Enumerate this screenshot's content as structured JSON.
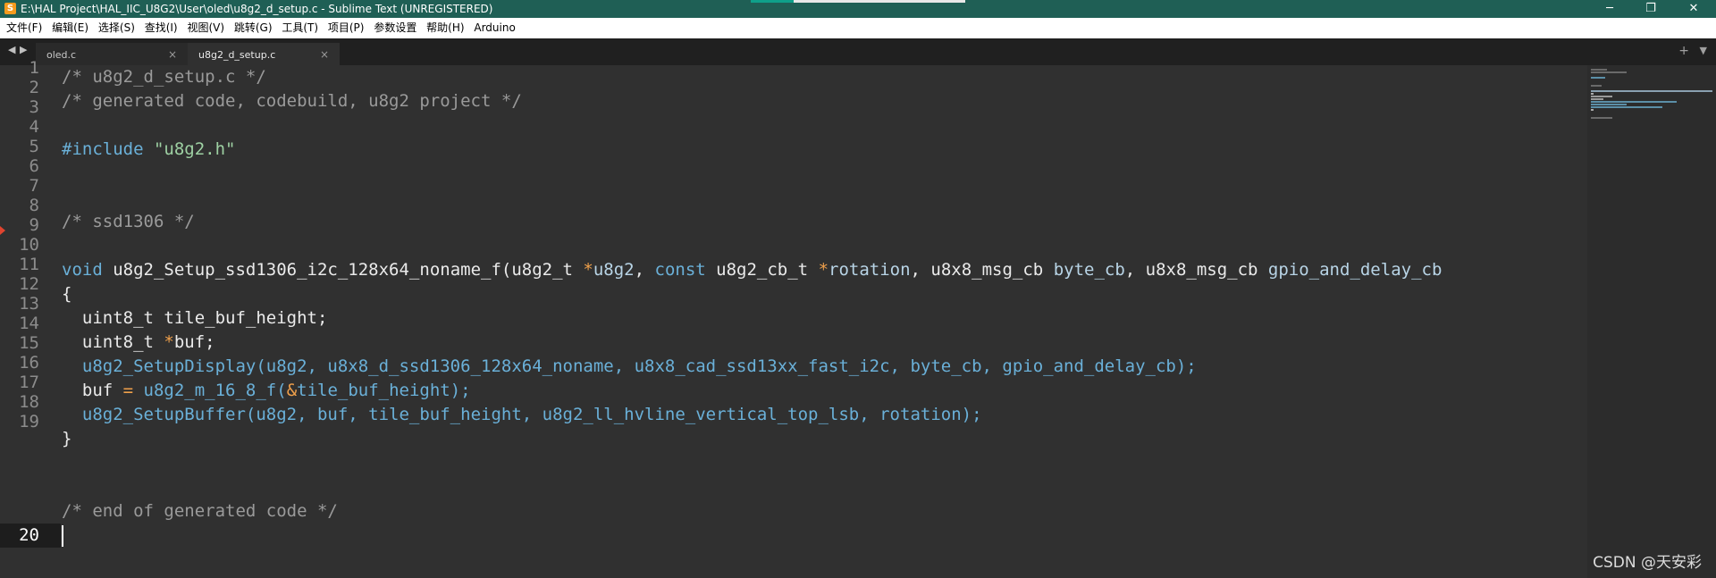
{
  "window": {
    "title": "E:\\HAL Project\\HAL_IIC_U8G2\\User\\oled\\u8g2_d_setup.c - Sublime Text (UNREGISTERED)",
    "app_icon": "S",
    "controls": {
      "minimize": "─",
      "maximize": "❐",
      "close": "✕"
    }
  },
  "menu": {
    "items": [
      "文件(F)",
      "编辑(E)",
      "选择(S)",
      "查找(I)",
      "视图(V)",
      "跳转(G)",
      "工具(T)",
      "项目(P)",
      "参数设置",
      "帮助(H)",
      "Arduino"
    ]
  },
  "tabs": {
    "nav_back": "◀",
    "nav_forward": "▶",
    "items": [
      {
        "label": "oled.c",
        "close": "×"
      },
      {
        "label": "u8g2_d_setup.c",
        "close": "×"
      }
    ],
    "new_tab": "+",
    "tab_list": "▼"
  },
  "editor": {
    "line_numbers": [
      "1",
      "2",
      "3",
      "4",
      "5",
      "6",
      "7",
      "8",
      "9",
      "10",
      "11",
      "12",
      "13",
      "14",
      "15",
      "16",
      "17",
      "18",
      "19",
      "20"
    ],
    "active_line": "20",
    "code": {
      "l1": "/* u8g2_d_setup.c */",
      "l2": "/* generated code, codebuild, u8g2 project */",
      "l4_pre": "#include ",
      "l4_str": "\"u8g2.h\"",
      "l7": "/* ssd1306 */",
      "l9_kw": "void",
      "l9_fn": " u8g2_Setup_ssd1306_i2c_128x64_noname_f",
      "l9_p1": "(u8g2_t ",
      "l9_star1": "*",
      "l9_p2": "u8g2",
      "l9_p3": ", ",
      "l9_const": "const",
      "l9_p4": " u8g2_cb_t ",
      "l9_star2": "*",
      "l9_p5": "rotation",
      "l9_p6": ", u8x8_msg_cb ",
      "l9_p7": "byte_cb",
      "l9_p8": ", u8x8_msg_cb ",
      "l9_p9": "gpio_and_delay_cb",
      "l10": "{",
      "l11": "  uint8_t tile_buf_height;",
      "l12_a": "  uint8_t ",
      "l12_star": "*",
      "l12_b": "buf;",
      "l13_fn": "  u8g2_SetupDisplay",
      "l13_args": "(u8g2, u8x8_d_ssd1306_128x64_noname, u8x8_cad_ssd13xx_fast_i2c, byte_cb, gpio_and_delay_cb);",
      "l14_a": "  buf ",
      "l14_eq": "=",
      "l14_fn": " u8g2_m_16_8_f",
      "l14_b": "(",
      "l14_amp": "&",
      "l14_c": "tile_buf_height);",
      "l15_fn": "  u8g2_SetupBuffer",
      "l15_args": "(u8g2, buf, tile_buf_height, u8g2_ll_hvline_vertical_top_lsb, rotation);",
      "l16": "}",
      "l19": "/* end of generated code */"
    }
  },
  "watermark": "CSDN @天安彩",
  "colors": {
    "title_bar": "#1f5f55",
    "editor_bg": "#303030",
    "comment": "#9a9a9a",
    "keyword": "#6ab0d8",
    "string": "#9ed1a3",
    "operator": "#f0a04b"
  }
}
